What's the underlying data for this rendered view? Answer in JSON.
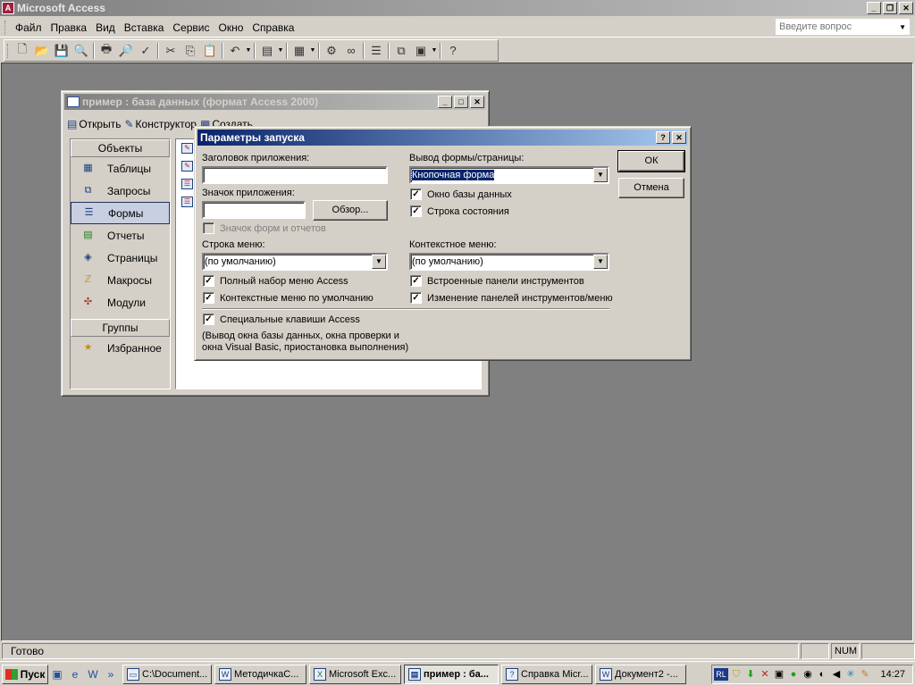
{
  "app": {
    "title": "Microsoft Access"
  },
  "menu": {
    "items": [
      "Файл",
      "Правка",
      "Вид",
      "Вставка",
      "Сервис",
      "Окно",
      "Справка"
    ],
    "ask_placeholder": "Введите вопрос"
  },
  "toolbar": {
    "icons": [
      "new-icon",
      "open-icon",
      "save-icon",
      "search-icon",
      "print-icon",
      "preview-icon",
      "spelling-icon",
      "cut-icon",
      "copy-icon",
      "paste-icon",
      "undo-icon",
      "office-links-icon",
      "analyze-icon",
      "code-icon",
      "script-icon",
      "properties-icon",
      "relationships-icon",
      "new-object-icon",
      "help-icon"
    ]
  },
  "db_window": {
    "title": "пример : база данных (формат Access 2000)",
    "toolbar": {
      "open": "Открыть",
      "design": "Конструктор",
      "create": "Создать"
    },
    "objects_header": "Объекты",
    "objects": [
      "Таблицы",
      "Запросы",
      "Формы",
      "Отчеты",
      "Страницы",
      "Макросы",
      "Модули"
    ],
    "selected": "Формы",
    "groups_header": "Группы",
    "groups": [
      "Избранное"
    ]
  },
  "dialog": {
    "title": "Параметры запуска",
    "app_title_label": "Заголовок приложения:",
    "app_title_value": "",
    "app_icon_label": "Значок приложения:",
    "app_icon_value": "",
    "browse_button": "Обзор...",
    "use_icon_checkbox": {
      "label": "Значок форм и отчетов",
      "checked": false,
      "disabled": true
    },
    "menu_bar_label": "Строка меню:",
    "menu_bar_value": "(по умолчанию)",
    "full_menus": {
      "label": "Полный набор меню Access",
      "checked": true
    },
    "default_shortcut_menus": {
      "label": "Контекстные меню по умолчанию",
      "checked": true
    },
    "display_form_label": "Вывод формы/страницы:",
    "display_form_value": "Кнопочная форма",
    "display_db_window": {
      "label": "Окно базы данных",
      "checked": true
    },
    "status_bar": {
      "label": "Строка состояния",
      "checked": true
    },
    "shortcut_menu_label": "Контекстное меню:",
    "shortcut_menu_value": "(по умолчанию)",
    "builtin_toolbars": {
      "label": "Встроенные панели инструментов",
      "checked": true
    },
    "toolbar_changes": {
      "label": "Изменение панелей инструментов/меню",
      "checked": true
    },
    "special_keys": {
      "label": "Специальные клавиши Access",
      "checked": true
    },
    "special_keys_note_1": "(Вывод окна базы данных, окна проверки и",
    "special_keys_note_2": "окна Visual Basic, приостановка выполнения)",
    "ok_button": "ОК",
    "cancel_button": "Отмена"
  },
  "status": {
    "text": "Готово",
    "num": "NUM"
  },
  "taskbar": {
    "start": "Пуск",
    "tasks": [
      "C:\\Document...",
      "МетодичкаС...",
      "Microsoft Exc...",
      "пример : ба...",
      "Справка Micr...",
      "Документ2 -..."
    ],
    "active_task": "пример : ба...",
    "lang": "RL",
    "clock": "14:27"
  }
}
